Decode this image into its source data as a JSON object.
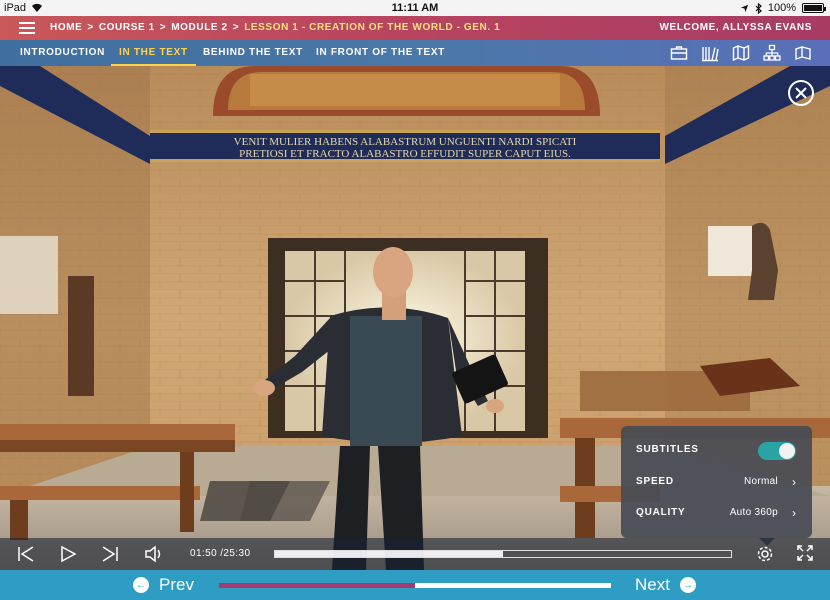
{
  "status_bar": {
    "device": "iPad",
    "time": "11:11 AM",
    "battery": "100%"
  },
  "header": {
    "breadcrumb": [
      "HOME",
      "COURSE 1",
      "MODULE 2",
      "LESSON 1 - CREATION OF THE WORLD - GEN. 1"
    ],
    "separator": ">",
    "welcome": "WELCOME, ALLYSSA EVANS"
  },
  "tabs": [
    {
      "label": "INTRODUCTION",
      "active": false
    },
    {
      "label": "IN THE TEXT",
      "active": true
    },
    {
      "label": "BEHIND THE TEXT",
      "active": false
    },
    {
      "label": "IN FRONT OF THE TEXT",
      "active": false
    }
  ],
  "tab_icons": [
    "briefcase-icon",
    "library-icon",
    "map-icon",
    "hierarchy-icon",
    "book-icon"
  ],
  "video": {
    "inscription_line1": "VENIT MULIER HABENS ALABASTRUM UNGUENTI NARDI SPICATI",
    "inscription_line2": "PRETIOSI ET FRACTO ALABASTRO EFFUDIT SUPER CAPUT EIUS."
  },
  "settings": {
    "subtitles_label": "SUBTITLES",
    "subtitles_on": true,
    "speed_label": "SPEED",
    "speed_value": "Normal",
    "quality_label": "QUALITY",
    "quality_value": "Auto 360p"
  },
  "player": {
    "current_time": "01:50",
    "duration": "25:30",
    "time_display": "01:50 /25:30",
    "buffered_fraction": 0.5
  },
  "bottom_nav": {
    "prev_label": "Prev",
    "next_label": "Next",
    "lesson_progress_fraction": 0.5
  },
  "colors": {
    "header_start": "#c9585a",
    "header_end": "#a83c64",
    "tabbar": "#4a78a8",
    "active_tab": "#ffd24a",
    "bottom_nav": "#2f9cc4",
    "toggle_on": "#29a3a3",
    "progress_fill": "#a33b70"
  }
}
